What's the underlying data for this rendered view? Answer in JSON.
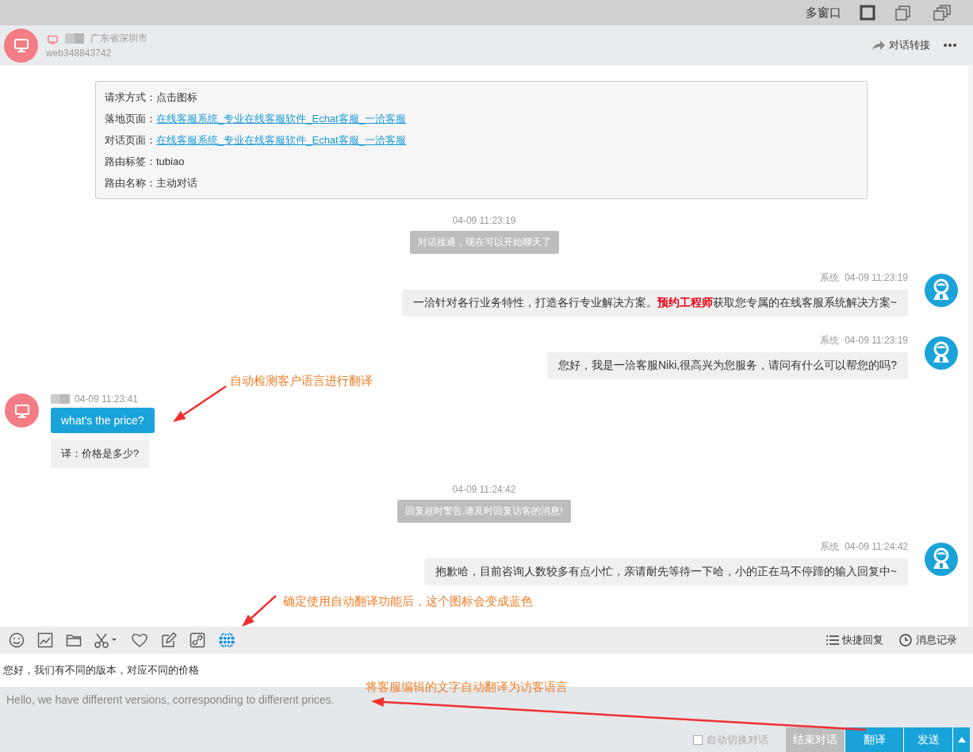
{
  "window_bar": {
    "label": "多窗口"
  },
  "header": {
    "location": "广东省深圳市",
    "visitor_id": "web348843742",
    "transfer": "对话转接"
  },
  "info_card": {
    "rows": [
      {
        "label": "请求方式：",
        "value": "点击图标",
        "kind": "text"
      },
      {
        "label": "落地页面：",
        "value": "在线客服系统_专业在线客服软件_Echat客服_一洽客服",
        "kind": "link"
      },
      {
        "label": "对话页面：",
        "value": "在线客服系统_专业在线客服软件_Echat客服_一洽客服",
        "kind": "link"
      },
      {
        "label": "路由标签：",
        "value": "tubiao",
        "kind": "text"
      },
      {
        "label": "路由名称：",
        "value": "主动对话",
        "kind": "text"
      }
    ]
  },
  "messages": [
    {
      "kind": "time",
      "text": "04-09 11:23:19"
    },
    {
      "kind": "notice",
      "text": "对话接通，现在可以开始聊天了"
    },
    {
      "kind": "agent",
      "sender": "系统",
      "time": "04-09 11:23:19",
      "text": "一洽针对各行业务特性，打造各行专业解决方案。**预约工程师**获取您专属的在线客服系统解决方案~"
    },
    {
      "kind": "agent",
      "sender": "系统",
      "time": "04-09 11:23:19",
      "text": "您好，我是一洽客服Niki,很高兴为您服务，请问有什么可以帮您的吗?"
    },
    {
      "kind": "visitor",
      "time": "04-09 11:23:41",
      "text": "what's the price?",
      "translation": "译：价格是多少?"
    },
    {
      "kind": "time",
      "text": "04-09 11:24:42"
    },
    {
      "kind": "notice",
      "text": "回复超时警告,请及时回复访客的消息!"
    },
    {
      "kind": "agent",
      "sender": "系统",
      "time": "04-09 11:24:42",
      "text": "抱歉哈，目前咨询人数较多有点小忙，亲请耐先等待一下哈，小的正在马不停蹄的输入回复中~"
    }
  ],
  "toolbar": {
    "translate_on": true,
    "right": [
      "快捷回复",
      "消息记录"
    ]
  },
  "composer": {
    "input": "您好，我们有不同的版本，对应不同的价格",
    "translation": "Hello, we have different versions, corresponding to different prices."
  },
  "bottom_bar": {
    "auto_switch": {
      "label": "自动切换对话",
      "checked": false
    },
    "buttons": [
      {
        "label": "结束对话",
        "kind": "secondary",
        "has_menu": false
      },
      {
        "label": "翻译",
        "kind": "primary",
        "has_menu": false
      },
      {
        "label": "发送",
        "kind": "primary",
        "has_menu": true
      }
    ]
  },
  "annotations": [
    {
      "text": "自动检测客户语言进行翻译"
    },
    {
      "text": "确定使用自动翻译功能后，这个图标会变成蓝色"
    },
    {
      "text": "将客服编辑的文字自动翻译为访客语言"
    }
  ]
}
